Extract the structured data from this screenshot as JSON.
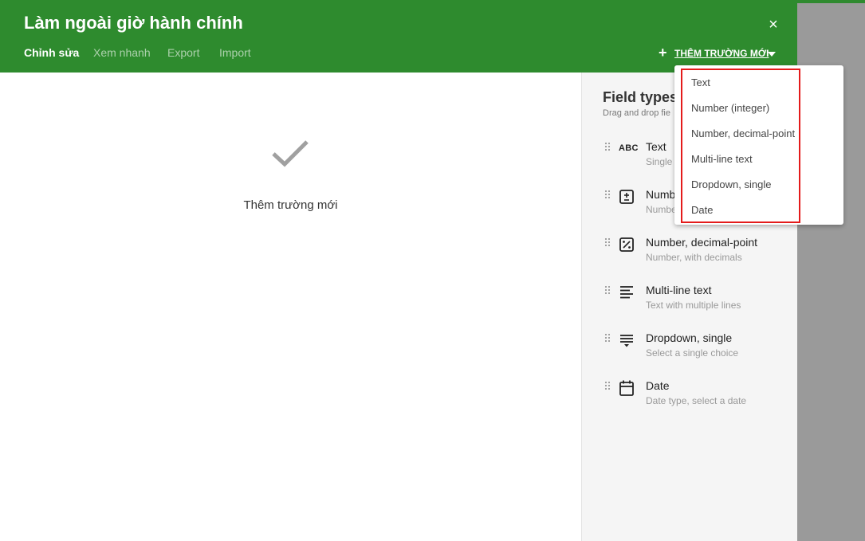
{
  "dialog": {
    "title": "Làm ngoài giờ hành chính",
    "close_label": "×",
    "tabs": [
      {
        "label": "Chỉnh sửa",
        "active": true
      },
      {
        "label": "Xem nhanh",
        "active": false
      },
      {
        "label": "Export",
        "active": false
      },
      {
        "label": "Import",
        "active": false
      }
    ],
    "add_field": {
      "icon": "plus-icon",
      "label": "THÊM TRƯỜNG MỚI",
      "caret": "caret-down-icon"
    }
  },
  "main": {
    "icon": "check-icon",
    "empty_text": "Thêm trường mới"
  },
  "panel": {
    "title": "Field types",
    "subtitle": "Drag and drop fie",
    "fields": [
      {
        "icon": "abc-icon",
        "icon_text": "ABC",
        "name": "Text",
        "desc": "Single"
      },
      {
        "icon": "plus-minus-box-icon",
        "name": "Numb",
        "desc": "Numbe"
      },
      {
        "icon": "percent-box-icon",
        "name": "Number, decimal-point",
        "desc": "Number, with decimals"
      },
      {
        "icon": "multiline-icon",
        "name": "Multi-line text",
        "desc": "Text with multiple lines"
      },
      {
        "icon": "dropdown-icon",
        "name": "Dropdown, single",
        "desc": "Select a single choice"
      },
      {
        "icon": "calendar-icon",
        "name": "Date",
        "desc": "Date type, select a date"
      }
    ]
  },
  "dropdown_menu": {
    "items": [
      "Text",
      "Number (integer)",
      "Number, decimal-point",
      "Multi-line text",
      "Dropdown, single",
      "Date"
    ]
  },
  "colors": {
    "header": "#2e8b2e",
    "highlight": "#e41b1b",
    "backdrop": "#9a9a9a"
  }
}
